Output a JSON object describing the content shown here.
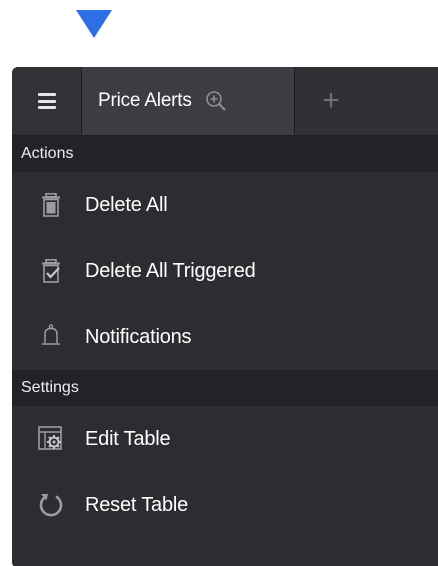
{
  "header": {
    "tab_label": "Price Alerts",
    "add_tab_label": "+"
  },
  "sections": {
    "actions": {
      "title": "Actions",
      "items": [
        {
          "label": "Delete All",
          "icon": "trash-icon"
        },
        {
          "label": "Delete All Triggered",
          "icon": "trash-check-icon"
        },
        {
          "label": "Notifications",
          "icon": "bell-icon"
        }
      ]
    },
    "settings": {
      "title": "Settings",
      "items": [
        {
          "label": "Edit Table",
          "icon": "table-gear-icon"
        },
        {
          "label": "Reset Table",
          "icon": "reset-icon"
        }
      ]
    }
  },
  "colors": {
    "pointer": "#2f6fe6",
    "panel_bg": "#2b2d31",
    "section_bg": "#222327",
    "active_tab_bg": "#3b3d42",
    "icon_gray": "#9a9ca1"
  }
}
